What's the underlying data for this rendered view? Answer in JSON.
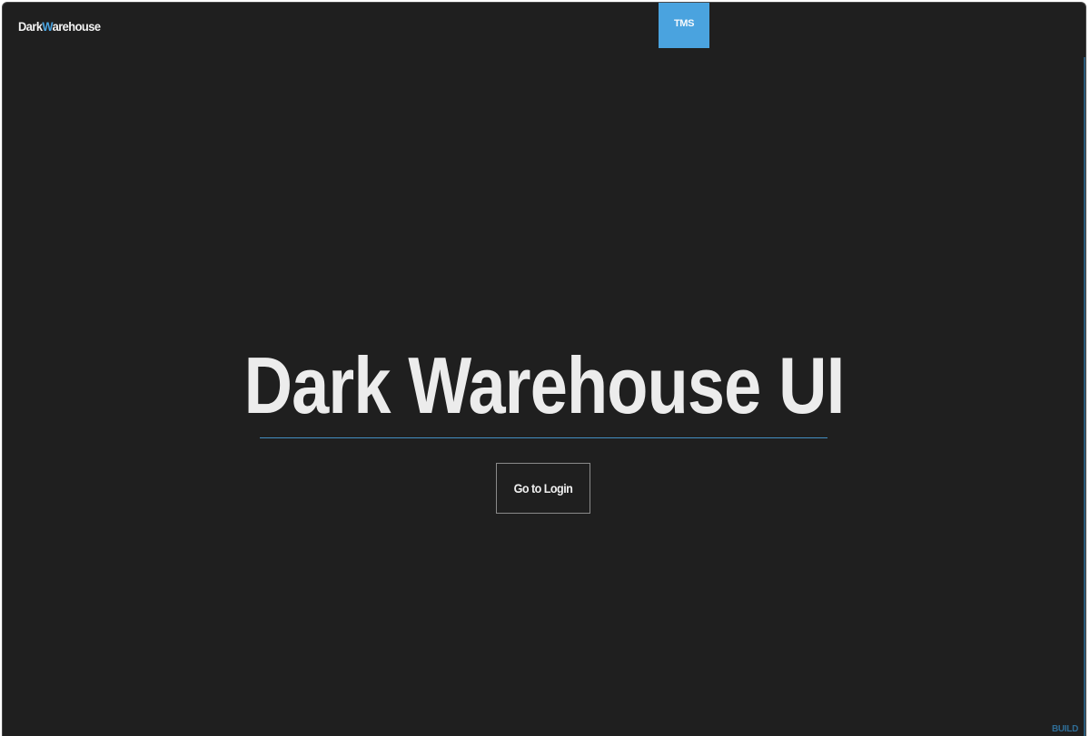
{
  "brand": {
    "prefix": "Dark",
    "highlight": "W",
    "suffix": "arehouse"
  },
  "nav": {
    "tms_tab": "TMS"
  },
  "hero": {
    "title": "Dark Warehouse UI",
    "login_button": "Go to Login"
  },
  "footer": {
    "build_label": "BUILD"
  },
  "colors": {
    "background": "#1f1f1f",
    "accent": "#4aa3df",
    "text": "#ececec"
  }
}
